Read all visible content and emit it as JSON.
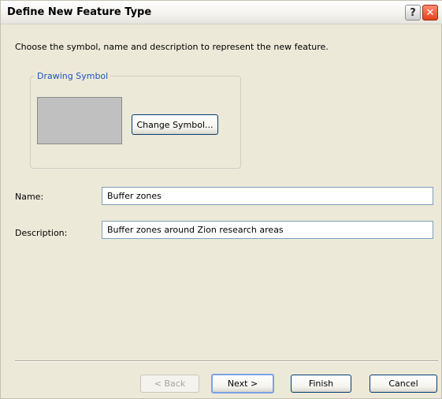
{
  "window": {
    "title": "Define New Feature Type",
    "help_glyph": "?",
    "close_glyph": "✕"
  },
  "intro_text": "Choose the symbol, name and description to represent the new feature.",
  "drawing_symbol": {
    "legend": "Drawing Symbol",
    "swatch_color": "#c0c0c0",
    "change_button": "Change Symbol..."
  },
  "fields": {
    "name_label": "Name:",
    "name_value": "Buffer zones",
    "description_label": "Description:",
    "description_value": "Buffer zones around Zion research areas"
  },
  "buttons": {
    "back": "< Back",
    "next": "Next >",
    "finish": "Finish",
    "cancel": "Cancel"
  }
}
